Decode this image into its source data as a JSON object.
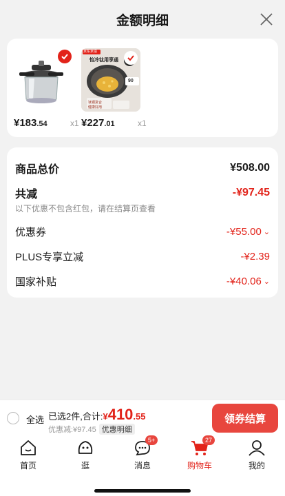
{
  "header": {
    "title": "金额明细"
  },
  "products": [
    {
      "price_int": "¥183",
      "price_dec": ".54",
      "qty": "x1",
      "image": "pressure-cooker"
    },
    {
      "price_int": "¥227",
      "price_dec": ".01",
      "qty": "x1",
      "image": "wok-pan",
      "image_text": {
        "top": "京东京造",
        "banner": "怡冷钛用享通",
        "badge": "0涂",
        "side": "90",
        "caption_a": "钛钢复合",
        "caption_b": "健康好用"
      }
    }
  ],
  "detail": {
    "total_label": "商品总价",
    "total_value": "¥508.00",
    "discount_label": "共减",
    "discount_value": "-¥97.45",
    "discount_note": "以下优惠不包含红包，请在结算页查看",
    "items": [
      {
        "label": "优惠券",
        "value": "-¥55.00",
        "chevron": true
      },
      {
        "label": "PLUS专享立减",
        "value": "-¥2.39",
        "chevron": false
      },
      {
        "label": "国家补贴",
        "value": "-¥40.06",
        "chevron": true
      }
    ]
  },
  "bottom": {
    "select_all": "全选",
    "summary_prefix": "已选2件,合计:",
    "amount_yen": "¥",
    "amount_int": "410",
    "amount_dec": ".55",
    "sub_text": "优惠减:¥97.45",
    "detail_chip": "优惠明细",
    "checkout": "领券结算"
  },
  "tabs": [
    {
      "label": "首页",
      "icon": "home-icon",
      "badge": ""
    },
    {
      "label": "逛",
      "icon": "face-icon",
      "badge": ""
    },
    {
      "label": "消息",
      "icon": "chat-icon",
      "badge": "5+"
    },
    {
      "label": "购物车",
      "icon": "cart-icon",
      "badge": "27",
      "active": true
    },
    {
      "label": "我的",
      "icon": "user-icon",
      "badge": ""
    }
  ],
  "colors": {
    "accent": "#e2231a",
    "button": "#e8463e"
  }
}
